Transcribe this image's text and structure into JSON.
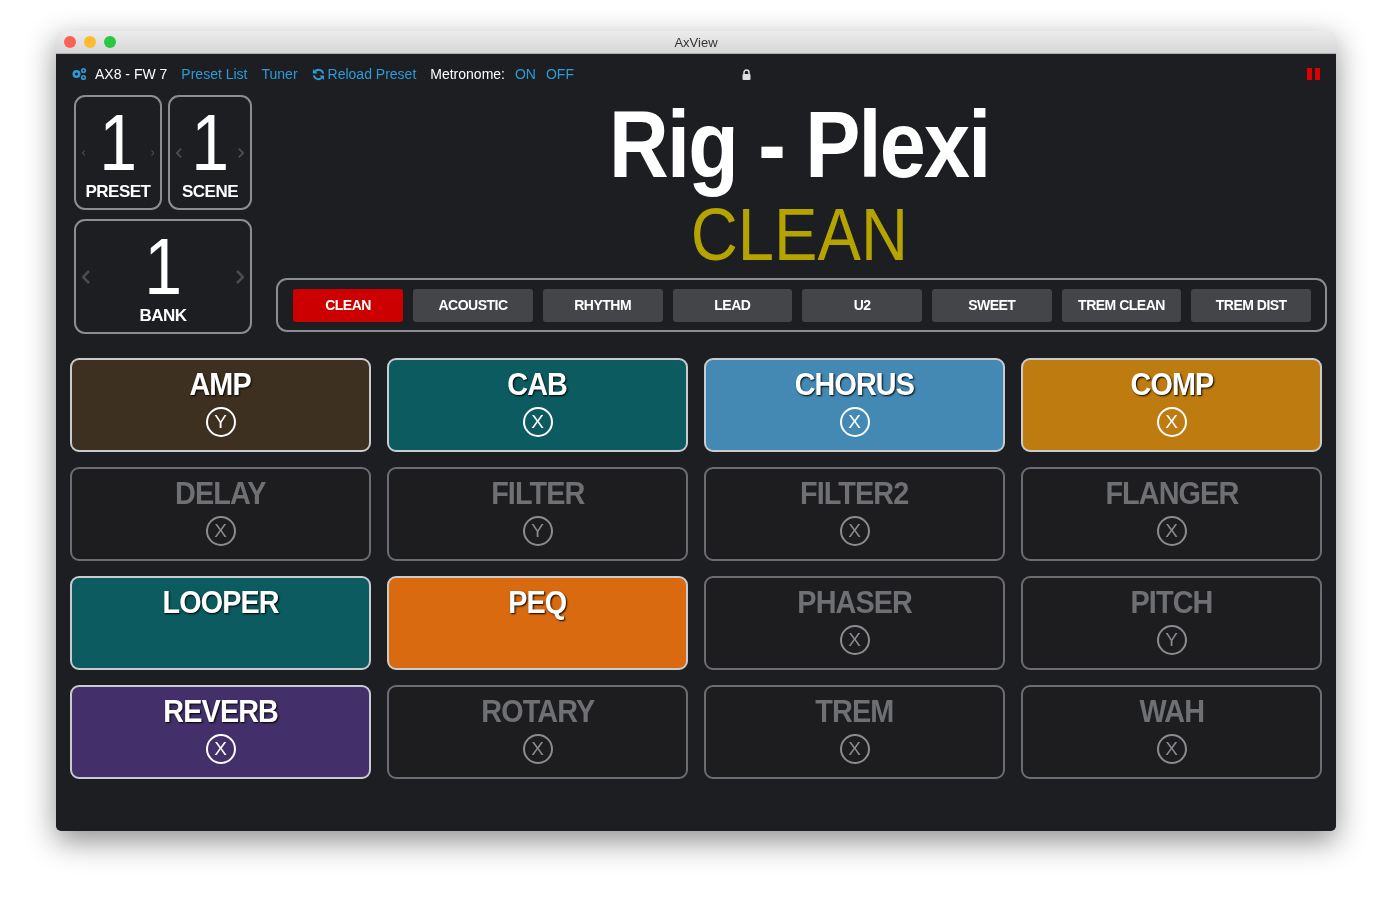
{
  "window": {
    "title": "AxView"
  },
  "toolbar": {
    "device": "AX8 - FW 7",
    "links": [
      "Preset List",
      "Tuner"
    ],
    "reload": "Reload Preset",
    "metronome_label": "Metronome:",
    "metronome_options": [
      "ON",
      "OFF"
    ]
  },
  "counters": [
    {
      "value": "1",
      "label": "PRESET"
    },
    {
      "value": "1",
      "label": "SCENE"
    },
    {
      "value": "1",
      "label": "BANK"
    }
  ],
  "preset_name": "Rig - Plexi",
  "scene_name": "CLEAN",
  "scenes": [
    {
      "label": "CLEAN",
      "selected": true
    },
    {
      "label": "ACOUSTIC",
      "selected": false
    },
    {
      "label": "RHYTHM",
      "selected": false
    },
    {
      "label": "LEAD",
      "selected": false
    },
    {
      "label": "U2",
      "selected": false
    },
    {
      "label": "SWEET",
      "selected": false
    },
    {
      "label": "TREM CLEAN",
      "selected": false
    },
    {
      "label": "TREM DIST",
      "selected": false
    }
  ],
  "blocks": [
    {
      "name": "AMP",
      "engaged": true,
      "color": "#3d3020",
      "channel": "Y"
    },
    {
      "name": "CAB",
      "engaged": true,
      "color": "#0b5b60",
      "channel": "X"
    },
    {
      "name": "CHORUS",
      "engaged": true,
      "color": "#4389b4",
      "channel": "X"
    },
    {
      "name": "COMP",
      "engaged": true,
      "color": "#be7c10",
      "channel": "X"
    },
    {
      "name": "DELAY",
      "engaged": false,
      "channel": "X"
    },
    {
      "name": "FILTER",
      "engaged": false,
      "channel": "Y"
    },
    {
      "name": "FILTER2",
      "engaged": false,
      "channel": "X"
    },
    {
      "name": "FLANGER",
      "engaged": false,
      "channel": "X"
    },
    {
      "name": "LOOPER",
      "engaged": true,
      "color": "#0b5b60"
    },
    {
      "name": "PEQ",
      "engaged": true,
      "color": "#d96a10"
    },
    {
      "name": "PHASER",
      "engaged": false,
      "channel": "X"
    },
    {
      "name": "PITCH",
      "engaged": false,
      "channel": "Y"
    },
    {
      "name": "REVERB",
      "engaged": true,
      "color": "#43306a",
      "channel": "X"
    },
    {
      "name": "ROTARY",
      "engaged": false,
      "channel": "X"
    },
    {
      "name": "TREM",
      "engaged": false,
      "channel": "X"
    },
    {
      "name": "WAH",
      "engaged": false,
      "channel": "X"
    }
  ]
}
